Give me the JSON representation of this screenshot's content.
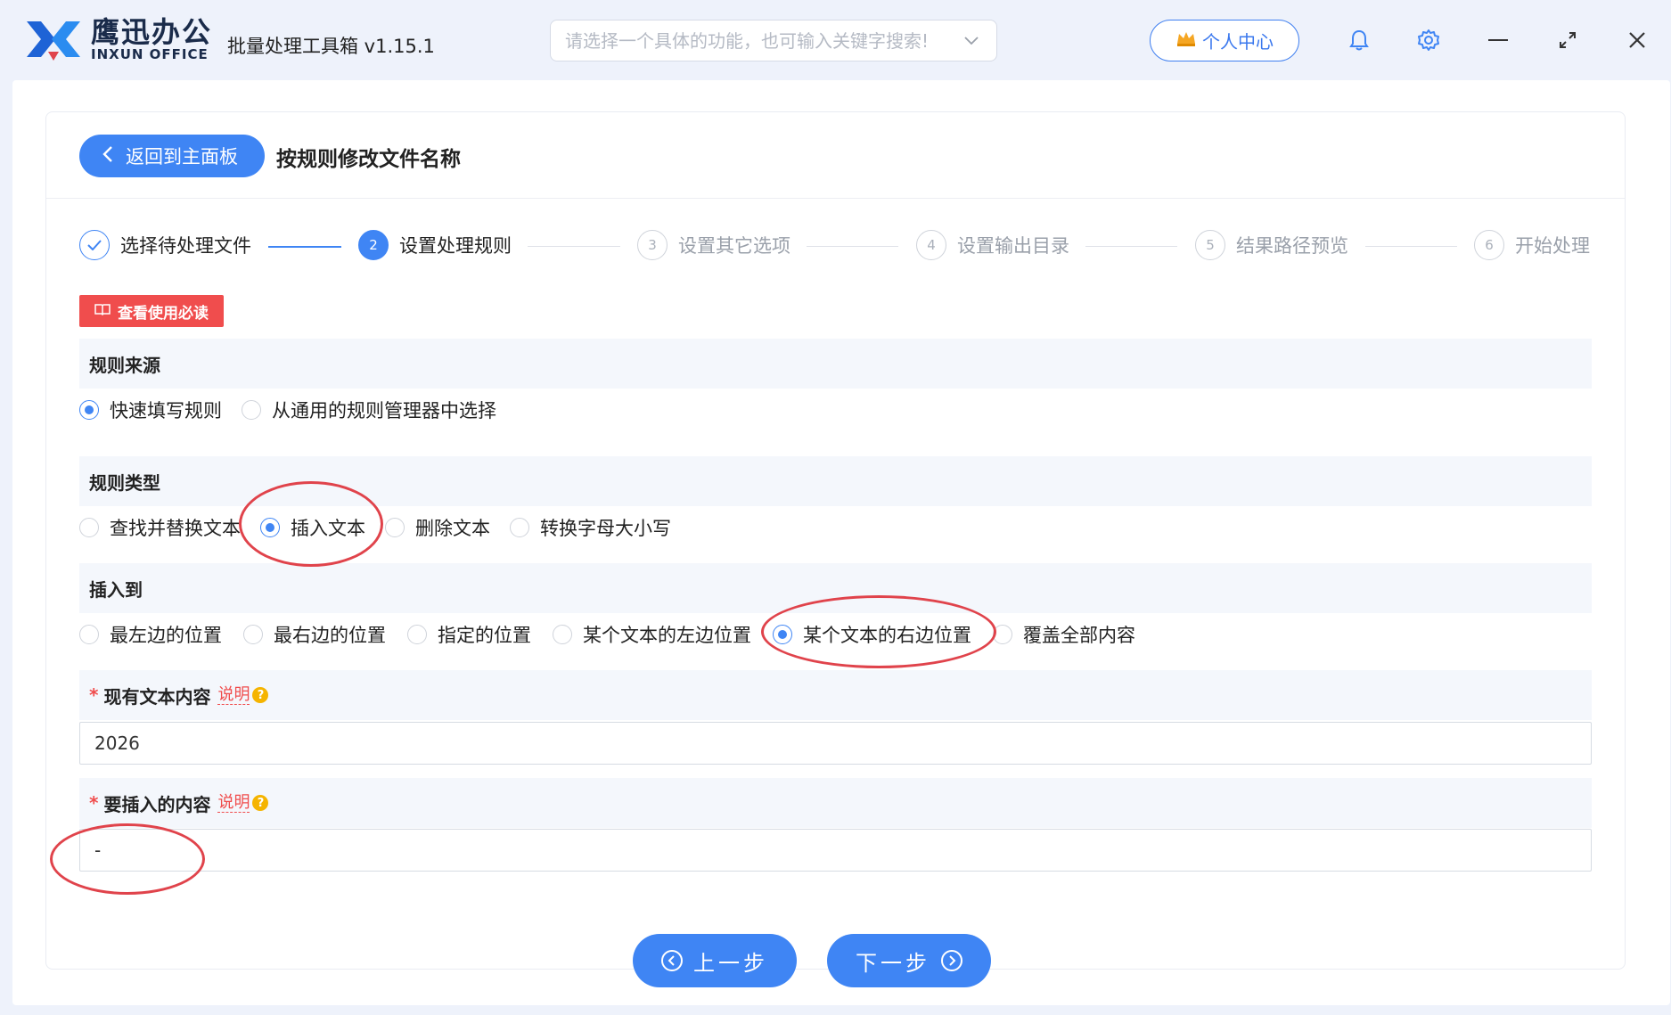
{
  "app": {
    "logo_cn": "鹰迅办公",
    "logo_en": "INXUN OFFICE",
    "name": "批量处理工具箱 v1.15.1"
  },
  "search": {
    "placeholder": "请选择一个具体的功能，也可输入关键字搜索!"
  },
  "header": {
    "user_center": "个人中心",
    "icons": [
      "bell-icon",
      "gear-icon",
      "minimize-icon",
      "maximize-icon",
      "close-icon"
    ]
  },
  "page": {
    "back_label": "返回到主面板",
    "title": "按规则修改文件名称"
  },
  "steps": [
    {
      "num": "1",
      "label": "选择待处理文件",
      "state": "done"
    },
    {
      "num": "2",
      "label": "设置处理规则",
      "state": "active"
    },
    {
      "num": "3",
      "label": "设置其它选项",
      "state": "pending"
    },
    {
      "num": "4",
      "label": "设置输出目录",
      "state": "pending"
    },
    {
      "num": "5",
      "label": "结果路径预览",
      "state": "pending"
    },
    {
      "num": "6",
      "label": "开始处理",
      "state": "pending"
    }
  ],
  "notice": {
    "label": "查看使用必读"
  },
  "rule_source": {
    "title": "规则来源",
    "options": [
      "快速填写规则",
      "从通用的规则管理器中选择"
    ],
    "selected": 0
  },
  "rule_type": {
    "title": "规则类型",
    "options": [
      "查找并替换文本",
      "插入文本",
      "删除文本",
      "转换字母大小写"
    ],
    "selected": 1
  },
  "insert_to": {
    "title": "插入到",
    "options": [
      "最左边的位置",
      "最右边的位置",
      "指定的位置",
      "某个文本的左边位置",
      "某个文本的右边位置",
      "覆盖全部内容"
    ],
    "selected": 4
  },
  "existing_text": {
    "required_mark": "*",
    "label": "现有文本内容",
    "help": "说明",
    "help_mark": "?",
    "value": "2026"
  },
  "insert_content": {
    "required_mark": "*",
    "label": "要插入的内容",
    "help": "说明",
    "help_mark": "?",
    "value": "-"
  },
  "nav": {
    "prev": "上一步",
    "next": "下一步"
  },
  "colors": {
    "accent": "#3f85f4",
    "notice": "#f04d4d",
    "annotation": "#e0434b"
  }
}
